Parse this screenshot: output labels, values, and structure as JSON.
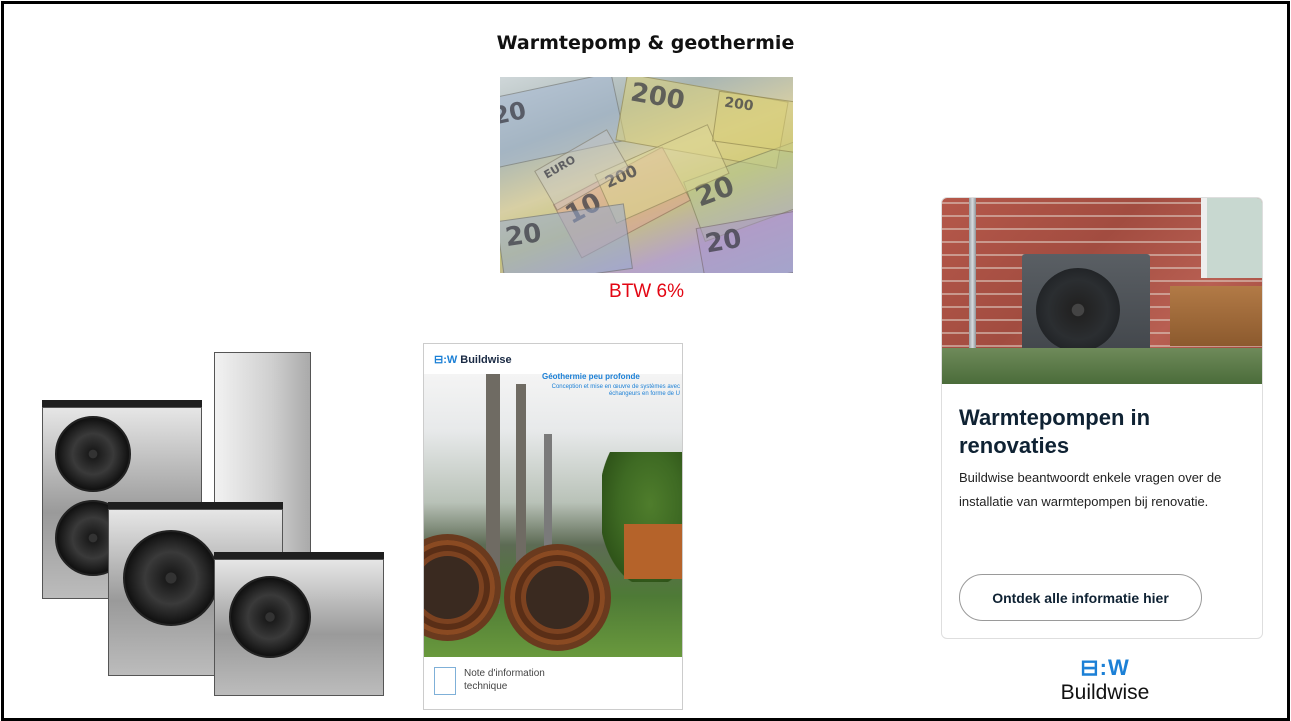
{
  "page": {
    "title": "Warmtepomp & geothermie"
  },
  "money_image": {
    "caption": "BTW 6%",
    "caption_color": "#e30613",
    "note_values": [
      "20",
      "200",
      "10",
      "20",
      "200",
      "20",
      "EURO",
      "200",
      "20"
    ]
  },
  "brochure": {
    "logo_mark": "⊟:W",
    "logo_text": "Buildwise",
    "title": "Géothermie peu profonde",
    "subtitle": "Conception et mise en œuvre de systèmes avec échangeurs en forme de U",
    "footer_text": "Note d'information technique"
  },
  "card": {
    "heading": "Warmtepompen in renovaties",
    "body": "Buildwise beantwoordt enkele vragen over de installatie van warmtepompen bij renovatie.",
    "button_label": "Ontdek alle informatie hier"
  },
  "buildwise_logo": {
    "mark": "⊟:W",
    "name": "Buildwise",
    "brand_color": "#1c80d6"
  }
}
